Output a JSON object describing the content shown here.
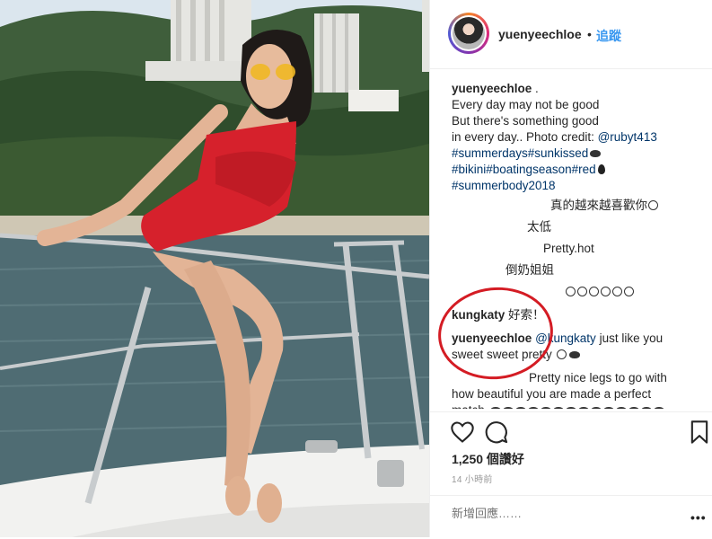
{
  "header": {
    "username": "yuenyeechloe",
    "dot": "•",
    "follow_label": "追蹤"
  },
  "caption": {
    "username": "yuenyeechloe",
    "after_user": " .",
    "line1": "Every day may not be good",
    "line2": "But there's something good",
    "line3_text": "in every day.. Photo credit: ",
    "line3_mention": "@rubyt413",
    "tags1": "#summerdays#sunkissed",
    "tags2": "#bikini#boatingseason#red",
    "tags3": "#summerbody2018"
  },
  "comments": {
    "c1": "真的越來越喜歡你",
    "c2": "太低",
    "c3": "Pretty.hot",
    "c4": "倒奶姐姐",
    "kungkaty_user": "kungkaty",
    "kungkaty_text": " 好索！",
    "reply_user": "yuenyeechloe",
    "reply_mention": "@kungkaty",
    "reply_text1": " just like you",
    "reply_text2": "sweet sweet pretty ",
    "long_line1": "Pretty nice legs to go with",
    "long_line2": "how beautiful you are made a perfect",
    "long_line3": "match "
  },
  "actions": {
    "icons": [
      "heart-icon",
      "comment-icon",
      "bookmark-icon"
    ],
    "likes": "1,250 個讚好",
    "time": "14 小時前"
  },
  "add_comment": {
    "placeholder": "新增回應……",
    "more": "•••"
  },
  "colors": {
    "link": "#003569",
    "follow": "#3897f0",
    "annotation": "#d41c24",
    "swimsuit": "#d6212c"
  }
}
